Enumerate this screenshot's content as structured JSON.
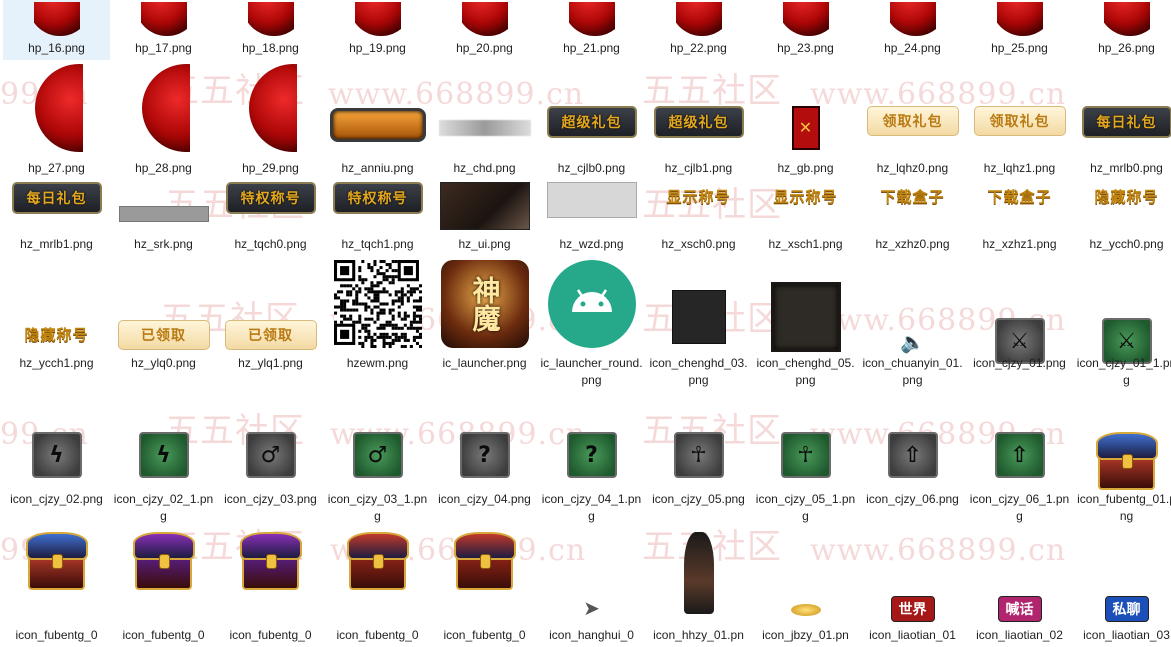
{
  "watermark": {
    "text_cn": "五五社区",
    "text_url": "www.668899.cn",
    "text_url_partial": "99.cn"
  },
  "files": [
    {
      "name": "hp_16.png",
      "icon": "red-moon-icon",
      "selected": true
    },
    {
      "name": "hp_17.png",
      "icon": "red-moon-icon"
    },
    {
      "name": "hp_18.png",
      "icon": "red-moon-icon"
    },
    {
      "name": "hp_19.png",
      "icon": "red-moon-icon"
    },
    {
      "name": "hp_20.png",
      "icon": "red-moon-icon"
    },
    {
      "name": "hp_21.png",
      "icon": "red-moon-icon"
    },
    {
      "name": "hp_22.png",
      "icon": "red-moon-icon"
    },
    {
      "name": "hp_23.png",
      "icon": "red-moon-icon"
    },
    {
      "name": "hp_24.png",
      "icon": "red-moon-icon"
    },
    {
      "name": "hp_25.png",
      "icon": "red-moon-icon"
    },
    {
      "name": "hp_26.png",
      "icon": "red-moon-icon"
    },
    {
      "name": "hp_27.png",
      "icon": "red-moon-icon"
    },
    {
      "name": "hp_28.png",
      "icon": "red-moon-icon"
    },
    {
      "name": "hp_29.png",
      "icon": "red-moon-icon"
    },
    {
      "name": "hz_anniu.png",
      "icon": "orange-button-icon"
    },
    {
      "name": "hz_chd.png",
      "icon": "grey-bar-icon"
    },
    {
      "name": "hz_cjlb0.png",
      "icon": "dark-plaque-icon",
      "text": "超级礼包"
    },
    {
      "name": "hz_cjlb1.png",
      "icon": "dark-plaque-icon",
      "text": "超级礼包"
    },
    {
      "name": "hz_gb.png",
      "icon": "red-close-icon",
      "text": "✕"
    },
    {
      "name": "hz_lqhz0.png",
      "icon": "gold-plaque-icon",
      "text": "领取礼包"
    },
    {
      "name": "hz_lqhz1.png",
      "icon": "gold-plaque-icon",
      "text": "领取礼包"
    },
    {
      "name": "hz_mrlb0.png",
      "icon": "dark-plaque-icon",
      "text": "每日礼包"
    },
    {
      "name": "hz_mrlb1.png",
      "icon": "dark-plaque-icon",
      "text": "每日礼包"
    },
    {
      "name": "hz_srk.png",
      "icon": "grey-input-icon"
    },
    {
      "name": "hz_tqch0.png",
      "icon": "dark-plaque-icon",
      "text": "特权称号"
    },
    {
      "name": "hz_tqch1.png",
      "icon": "dark-plaque-icon",
      "text": "特权称号"
    },
    {
      "name": "hz_ui.png",
      "icon": "game-ui-panel-icon"
    },
    {
      "name": "hz_wzd.png",
      "icon": "grey-box-icon"
    },
    {
      "name": "hz_xsch0.png",
      "icon": "gold-text-icon",
      "text": "显示称号"
    },
    {
      "name": "hz_xsch1.png",
      "icon": "gold-text-icon",
      "text": "显示称号"
    },
    {
      "name": "hz_xzhz0.png",
      "icon": "gold-text-icon",
      "text": "下载盒子"
    },
    {
      "name": "hz_xzhz1.png",
      "icon": "gold-text-icon",
      "text": "下载盒子"
    },
    {
      "name": "hz_ycch0.png",
      "icon": "gold-text-icon",
      "text": "隐藏称号"
    },
    {
      "name": "hz_ycch1.png",
      "icon": "gold-text-icon",
      "text": "隐藏称号"
    },
    {
      "name": "hz_ylq0.png",
      "icon": "gold-plaque-icon",
      "text": "已领取"
    },
    {
      "name": "hz_ylq1.png",
      "icon": "gold-plaque-icon",
      "text": "已领取"
    },
    {
      "name": "hzewm.png",
      "icon": "qr-code-icon"
    },
    {
      "name": "ic_launcher.png",
      "icon": "game-logo-icon",
      "text": "神魔"
    },
    {
      "name": "ic_launcher_round.png",
      "icon": "android-icon"
    },
    {
      "name": "icon_chenghd_03.png",
      "icon": "dark-square-icon"
    },
    {
      "name": "icon_chenghd_05.png",
      "icon": "dark-frame-icon"
    },
    {
      "name": "icon_chuanyin_01.png",
      "icon": "speaker-icon"
    },
    {
      "name": "icon_cjzy_01.png",
      "icon": "stone-sword-icon",
      "glyph": "⚔"
    },
    {
      "name": "icon_cjzy_01_1.png",
      "icon": "green-stone-sword-icon",
      "glyph": "⚔"
    },
    {
      "name": "icon_cjzy_02.png",
      "icon": "stone-staff-icon",
      "glyph": "ϟ"
    },
    {
      "name": "icon_cjzy_02_1.png",
      "icon": "green-stone-staff-icon",
      "glyph": "ϟ"
    },
    {
      "name": "icon_cjzy_03.png",
      "icon": "stone-wand-icon",
      "glyph": "♂"
    },
    {
      "name": "icon_cjzy_03_1.png",
      "icon": "green-stone-wand-icon",
      "glyph": "♂"
    },
    {
      "name": "icon_cjzy_04.png",
      "icon": "stone-question-icon",
      "glyph": "?"
    },
    {
      "name": "icon_cjzy_04_1.png",
      "icon": "green-stone-question-icon",
      "glyph": "?"
    },
    {
      "name": "icon_cjzy_05.png",
      "icon": "stone-ankh-icon",
      "glyph": "☥"
    },
    {
      "name": "icon_cjzy_05_1.png",
      "icon": "green-stone-ankh-icon",
      "glyph": "☥"
    },
    {
      "name": "icon_cjzy_06.png",
      "icon": "stone-arrow-icon",
      "glyph": "⇧"
    },
    {
      "name": "icon_cjzy_06_1.png",
      "icon": "green-stone-arrow-icon",
      "glyph": "⇧"
    },
    {
      "name": "icon_fubentg_01.png",
      "icon": "blue-chest-icon"
    },
    {
      "name": "icon_fubentg_0",
      "icon": "blue-chest-icon"
    },
    {
      "name": "icon_fubentg_0",
      "icon": "purple-chest-icon"
    },
    {
      "name": "icon_fubentg_0",
      "icon": "purple-chest-icon"
    },
    {
      "name": "icon_fubentg_0",
      "icon": "red-chest-icon"
    },
    {
      "name": "icon_fubentg_0",
      "icon": "red-chest-icon"
    },
    {
      "name": "icon_hanghui_0",
      "icon": "cursor-icon",
      "glyph": "➤"
    },
    {
      "name": "icon_hhzy_01.pn",
      "icon": "dark-statue-icon"
    },
    {
      "name": "icon_jbzy_01.pn",
      "icon": "gold-coins-icon"
    },
    {
      "name": "icon_liaotian_01",
      "icon": "chat-world-icon",
      "text": "世界"
    },
    {
      "name": "icon_liaotian_02",
      "icon": "chat-shout-icon",
      "text": "喊话"
    },
    {
      "name": "icon_liaotian_03",
      "icon": "chat-private-icon",
      "text": "私聊"
    }
  ],
  "colors": {
    "selection": "#e5f1fb",
    "watermark": "#dc7878",
    "label_text": "#222222"
  }
}
